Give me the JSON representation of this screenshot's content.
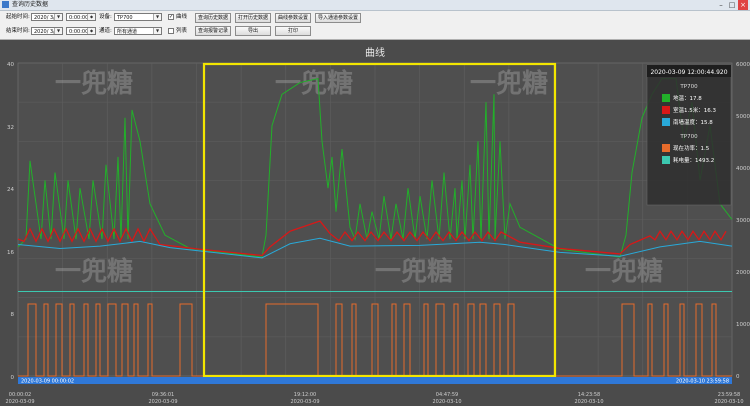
{
  "window": {
    "title": "查询历史数据"
  },
  "toolbar": {
    "start_label": "起始时间:",
    "start_date": "2020/ 3/ 9",
    "start_time": "0:00:00",
    "end_label": "结束时间:",
    "end_date": "2020/ 3/11",
    "end_time": "0:00:00",
    "device_label": "设备:",
    "device_value": "TP700",
    "channel_label": "通道:",
    "channel_value": "所有通道",
    "curve_check_label": "曲线",
    "list_check_label": "列表",
    "buttons": {
      "query_history": "查询历史数据",
      "open_history": "打开历史数据",
      "curve_params": "曲线参数设置",
      "import_channel": "导入通道参数设置",
      "query_alarm": "查询报警记录",
      "export": "导出",
      "print": "打印"
    }
  },
  "chart": {
    "title": "曲线",
    "left_ticks": [
      "40",
      "32",
      "24",
      "16",
      "8",
      "0"
    ],
    "right_ticks": [
      "6000",
      "5000",
      "4000",
      "3000",
      "2000",
      "1000",
      "0"
    ],
    "x_ticks": [
      {
        "label": "00:00:02",
        "date": "2020-03-09"
      },
      {
        "label": "09:36:01",
        "date": "2020-03-09"
      },
      {
        "label": "19:12:00",
        "date": "2020-03-09"
      },
      {
        "label": "04:47:59",
        "date": "2020-03-10"
      },
      {
        "label": "14:23:58",
        "date": "2020-03-10"
      },
      {
        "label": "23:59:58",
        "date": "2020-03-10"
      }
    ],
    "scroll_start": "2020-03-09 00:00:02",
    "scroll_end": "2020-03-10 23:59:58",
    "watermark": "一兜糖",
    "highlight_color": "#f3e600"
  },
  "tooltip": {
    "time": "2020-03-09 12:00:44.920",
    "group1": "TP700",
    "items1": [
      {
        "text": "地温：17.8",
        "color": "#22b02a"
      },
      {
        "text": "室温1.5米：16.3",
        "color": "#d81818"
      },
      {
        "text": "南墙温度：15.8",
        "color": "#29a9d8"
      }
    ],
    "group2": "TP700",
    "items2": [
      {
        "text": "现在功率：1.5",
        "color": "#e66b2b"
      },
      {
        "text": "耗电量：1493.2",
        "color": "#3cc8b0"
      }
    ]
  },
  "chart_data": {
    "type": "line",
    "x": [
      "00:00:02",
      "09:36:01",
      "19:12:00",
      "04:47:59",
      "14:23:58",
      "23:59:58"
    ],
    "series": [
      {
        "name": "地温",
        "axis": "left",
        "color": "#22b02a",
        "note": "cyclic, peaks ~28-38"
      },
      {
        "name": "室温1.5米",
        "axis": "left",
        "color": "#d81818"
      },
      {
        "name": "南墙温度",
        "axis": "left",
        "color": "#29a9d8"
      },
      {
        "name": "现在功率",
        "axis": "left",
        "color": "#e66b2b",
        "note": "on/off pulses 0-9"
      },
      {
        "name": "耗电量",
        "axis": "left",
        "color": "#3cc8b0"
      }
    ],
    "ylim_left": [
      0,
      40
    ],
    "ylim_right": [
      0,
      6000
    ]
  }
}
